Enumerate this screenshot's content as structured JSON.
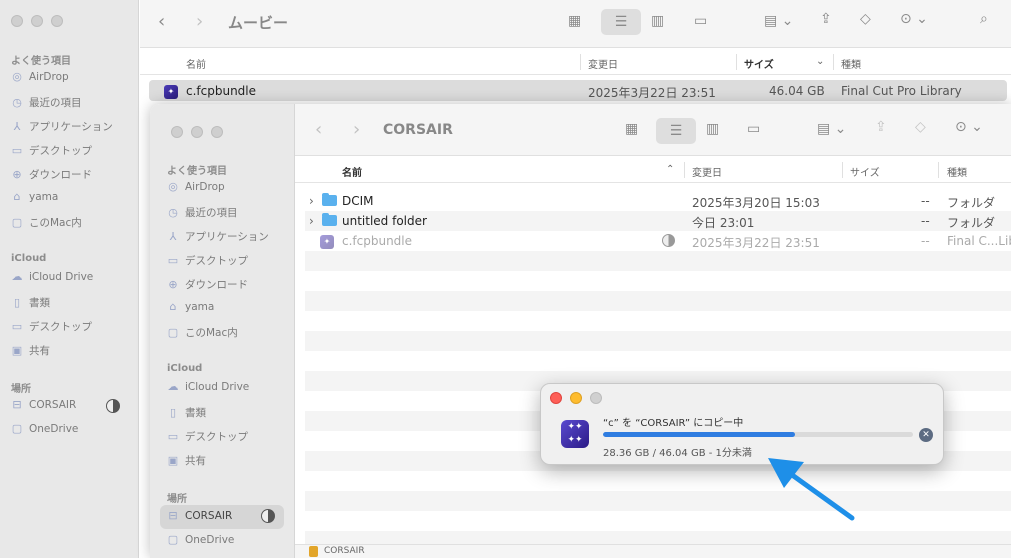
{
  "back_window": {
    "title": "ムービー",
    "sidebar": {
      "favorites_label": "よく使う項目",
      "favorites": [
        "AirDrop",
        "最近の項目",
        "アプリケーション",
        "デスクトップ",
        "ダウンロード",
        "yama",
        "このMac内"
      ],
      "icloud_label": "iCloud",
      "icloud": [
        "iCloud Drive",
        "書類",
        "デスクトップ",
        "共有"
      ],
      "locations_label": "場所",
      "locations": [
        "CORSAIR",
        "OneDrive"
      ]
    },
    "columns": {
      "name": "名前",
      "modified": "変更日",
      "size": "サイズ",
      "kind": "種類"
    },
    "row": {
      "name": "c.fcpbundle",
      "modified": "2025年3月22日 23:51",
      "size": "46.04 GB",
      "kind": "Final Cut Pro Library"
    }
  },
  "front_window": {
    "title": "CORSAIR",
    "sidebar": {
      "favorites_label": "よく使う項目",
      "favorites": [
        "AirDrop",
        "最近の項目",
        "アプリケーション",
        "デスクトップ",
        "ダウンロード",
        "yama",
        "このMac内"
      ],
      "icloud_label": "iCloud",
      "icloud": [
        "iCloud Drive",
        "書類",
        "デスクトップ",
        "共有"
      ],
      "locations_label": "場所",
      "locations": [
        "CORSAIR",
        "OneDrive"
      ]
    },
    "columns": {
      "name": "名前",
      "modified": "変更日",
      "size": "サイズ",
      "kind": "種類"
    },
    "rows": [
      {
        "name": "DCIM",
        "modified": "2025年3月20日 15:03",
        "size": "--",
        "kind": "フォルダ"
      },
      {
        "name": "untitled folder",
        "modified": "今日 23:01",
        "size": "--",
        "kind": "フォルダ"
      },
      {
        "name": "c.fcpbundle",
        "modified": "2025年3月22日 23:51",
        "size": "--",
        "kind": "Final C...Lib"
      }
    ],
    "pathbar": "CORSAIR"
  },
  "copy_dialog": {
    "title": "“c” を “CORSAIR” にコピー中",
    "status": "28.36 GB / 46.04 GB - 1分未満",
    "progress": 0.62
  },
  "colors": {
    "accent": "#2f7de1",
    "arrow": "#1e8fe8"
  }
}
